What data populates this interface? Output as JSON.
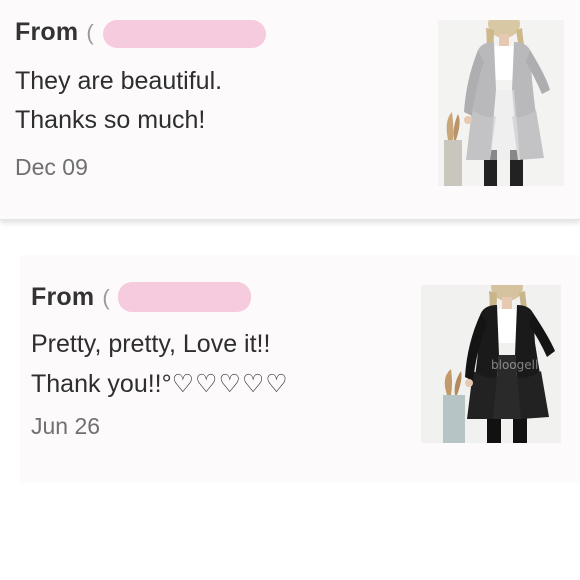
{
  "reviews": [
    {
      "from_label": "From",
      "from_paren": "(",
      "message_line1": "They are beautiful.",
      "message_line2": "Thanks so much!",
      "date": "Dec 09",
      "product_image_alt": "light gray knit cardigan",
      "redaction_color": "#f7c8dc"
    },
    {
      "from_label": "From",
      "from_paren": "(",
      "message_line1": "Pretty, pretty, Love it!!",
      "message_line2_text": "Thank you!!°",
      "message_line2_hearts": "♡♡♡♡♡",
      "date": "Jun 26",
      "product_image_alt": "black knit cardigan",
      "watermark": "bloogell",
      "redaction_color": "#f7c8dc"
    }
  ],
  "colors": {
    "card_background": "#fcfafb",
    "text_primary": "#2e2e2e",
    "text_secondary": "#707070"
  }
}
